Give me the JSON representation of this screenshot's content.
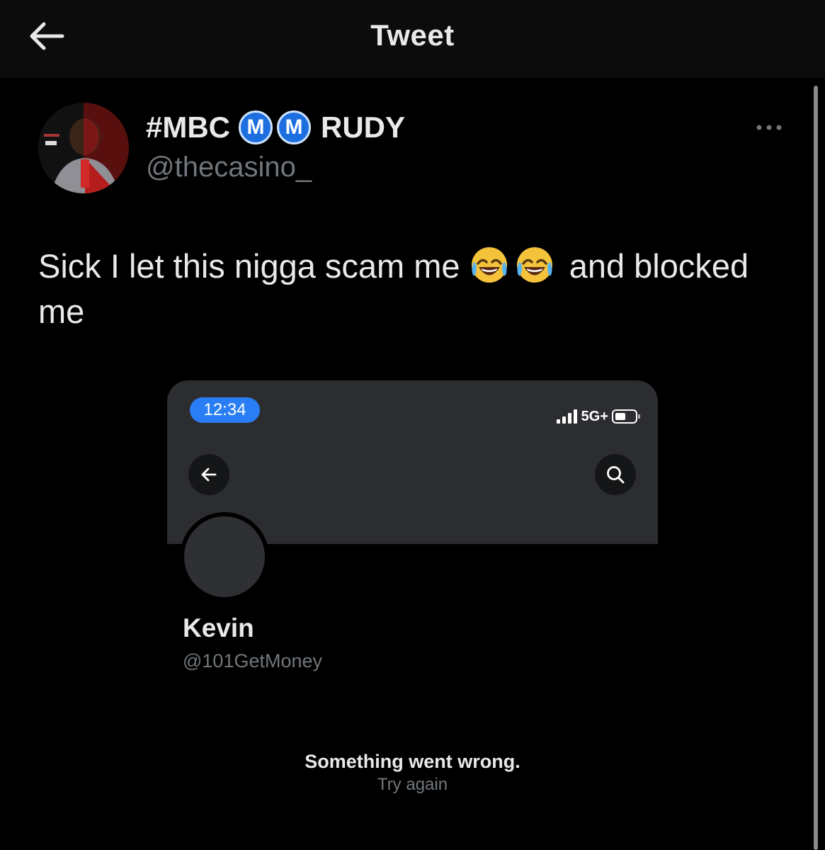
{
  "header": {
    "title": "Tweet",
    "back_icon": "arrow-left-icon"
  },
  "tweet": {
    "author": {
      "display_name_prefix": "#MBC",
      "badges": [
        "M",
        "M"
      ],
      "display_name_suffix": "RUDY",
      "handle": "@thecasino_"
    },
    "text_before_emoji": "Sick I let this nigga scam me",
    "emojis": [
      "face-with-tears-of-joy-icon",
      "face-with-tears-of-joy-icon"
    ],
    "text_after_emoji": "and blocked me",
    "more_icon": "ellipsis-icon"
  },
  "screenshot": {
    "status_time": "12:34",
    "network": "5G+",
    "profile_name": "Kevin",
    "profile_handle": "@101GetMoney",
    "error_message": "Something went wrong.",
    "retry_label": "Try again"
  },
  "colors": {
    "background": "#000000",
    "text": "#e7e9ea",
    "muted": "#71767b",
    "accent": "#2a7ef5"
  }
}
